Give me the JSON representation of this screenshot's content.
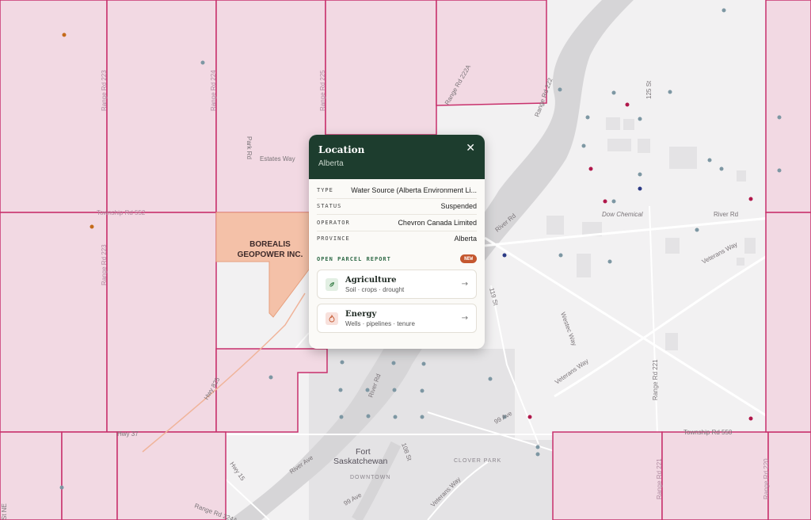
{
  "colors": {
    "parcel_fill": "#f2d9e3",
    "parcel_border": "#c8306c",
    "highlight_fill": "#f4c1a8",
    "river": "#d4d4d6",
    "popup_header": "#1d3d2e",
    "accent_new": "#c4572f"
  },
  "map": {
    "highlight_label_line1": "BOREALIS",
    "highlight_label_line2": "GEOPOWER INC.",
    "labels": {
      "estates_way": "Estates Way",
      "park_rd": "Park Rd",
      "range_rd_222a": "Range Rd 222A",
      "range_rd_222": "Range Rd 222",
      "st_125": "125 St",
      "dow_chemical": "Dow Chemical",
      "river_rd_left": "River Rd",
      "river_rd_right": "River Rd",
      "veterans_way_upper": "Veterans Way",
      "veterans_way_lower": "Veterans Way",
      "veterans_way_bottom": "Veterans Way",
      "st_119": "119 St",
      "westec_way": "Westec Way",
      "range_rd_221": "Range Rd 221",
      "hwy_825": "Hwy 825",
      "hwy_37": "Hwy 37",
      "hwy_15": "Hwy 15",
      "river_ave": "River Ave",
      "ave_99_right": "99 Ave",
      "ave_99_left": "99 Ave",
      "st_108": "108 St",
      "fort": "Fort",
      "saskatchewan": "Saskatchewan",
      "downtown": "DOWNTOWN",
      "clover_park": "CLOVER PARK",
      "township_rd_550": "Township Rd 550",
      "township_rd_552": "Township Rd 552",
      "st_ne": "St NE",
      "range_rd_223_a": "Range Rd 223",
      "range_rd_223_b": "Range Rd 223",
      "range_rd_224": "Range Rd 224",
      "range_rd_225": "Range Rd 225",
      "river_rd_mid": "River Rd",
      "range_rd_221_b": "Range Rd 221",
      "range_rd_220": "Range Rd 220",
      "range_rd_224a": "Range Rd 224A"
    }
  },
  "popup": {
    "title": "Location",
    "subtitle": "Alberta",
    "close_icon": "close-icon",
    "rows": [
      {
        "key": "TYPE",
        "value": "Water Source (Alberta Environment Li..."
      },
      {
        "key": "STATUS",
        "value": "Suspended"
      },
      {
        "key": "OPERATOR",
        "value": "Chevron Canada Limited"
      },
      {
        "key": "PROVINCE",
        "value": "Alberta"
      }
    ],
    "report": {
      "title": "OPEN PARCEL REPORT",
      "badge": "NEW",
      "cards": [
        {
          "title": "Agriculture",
          "subtitle": "Soil · crops · drought",
          "icon": "leaf-icon"
        },
        {
          "title": "Energy",
          "subtitle": "Wells · pipelines · tenure",
          "icon": "flame-icon"
        }
      ]
    }
  }
}
